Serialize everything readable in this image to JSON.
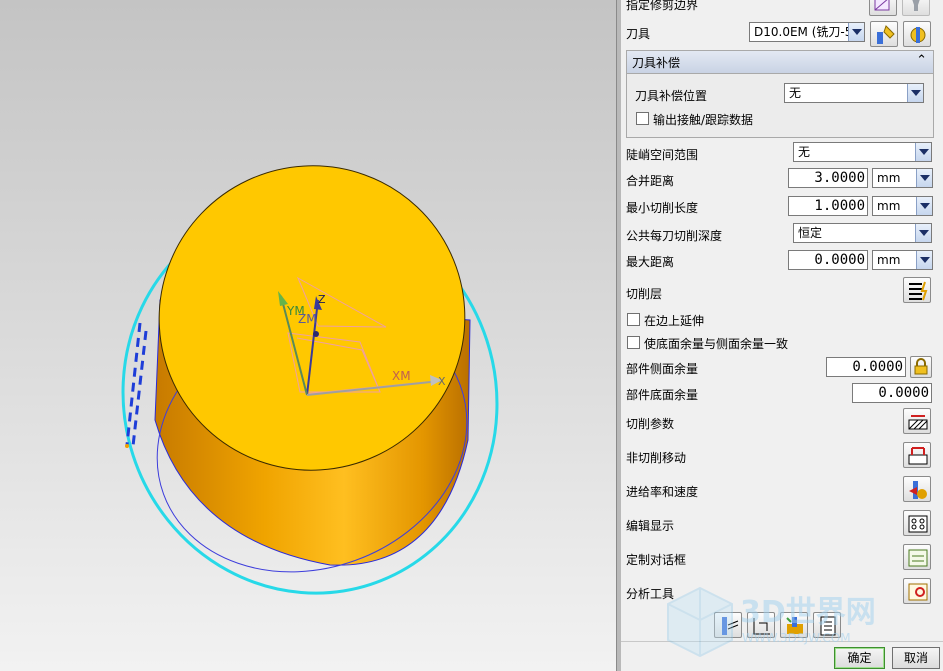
{
  "panel": {
    "trim_boundary_label": "指定修剪边界",
    "tool_label": "刀具",
    "tool_value": "D10.0EM (铣刀-5",
    "comp_group_title": "刀具补偿",
    "comp_position_label": "刀具补偿位置",
    "comp_position_value": "无",
    "output_contact_label": "输出接触/跟踪数据",
    "steep_range_label": "陡峭空间范围",
    "steep_range_value": "无",
    "merge_distance_label": "合并距离",
    "merge_distance_value": "3.0000",
    "merge_distance_unit": "mm",
    "min_cut_length_label": "最小切削长度",
    "min_cut_length_value": "1.0000",
    "min_cut_length_unit": "mm",
    "common_depth_label": "公共每刀切削深度",
    "common_depth_value": "恒定",
    "max_distance_label": "最大距离",
    "max_distance_value": "0.0000",
    "max_distance_unit": "mm",
    "cut_levels_label": "切削层",
    "extend_edges_label": "在边上延伸",
    "floor_same_as_side_label": "使底面余量与侧面余量一致",
    "part_side_stock_label": "部件侧面余量",
    "part_side_stock_value": "0.0000",
    "part_floor_stock_label": "部件底面余量",
    "part_floor_stock_value": "0.0000",
    "cutting_params_label": "切削参数",
    "non_cutting_moves_label": "非切削移动",
    "feeds_speeds_label": "进给率和速度",
    "edit_display_label": "编辑显示",
    "custom_dialog_label": "定制对话框",
    "analysis_tools_label": "分析工具",
    "ok_label": "确定",
    "cancel_label": "取消"
  },
  "viewport": {
    "axis_xm": "XM",
    "axis_ym": "YM",
    "axis_zm": "ZM",
    "axis_x": "X",
    "axis_z": "Z",
    "part_color": "#ffc800",
    "part_side_color": "#e59a00",
    "boundary_color": "#27d9e8",
    "toolpath_color": "#1e3dd8"
  },
  "watermark": {
    "text": "3D世界网",
    "url": "WWW.3DSJW.COM"
  }
}
